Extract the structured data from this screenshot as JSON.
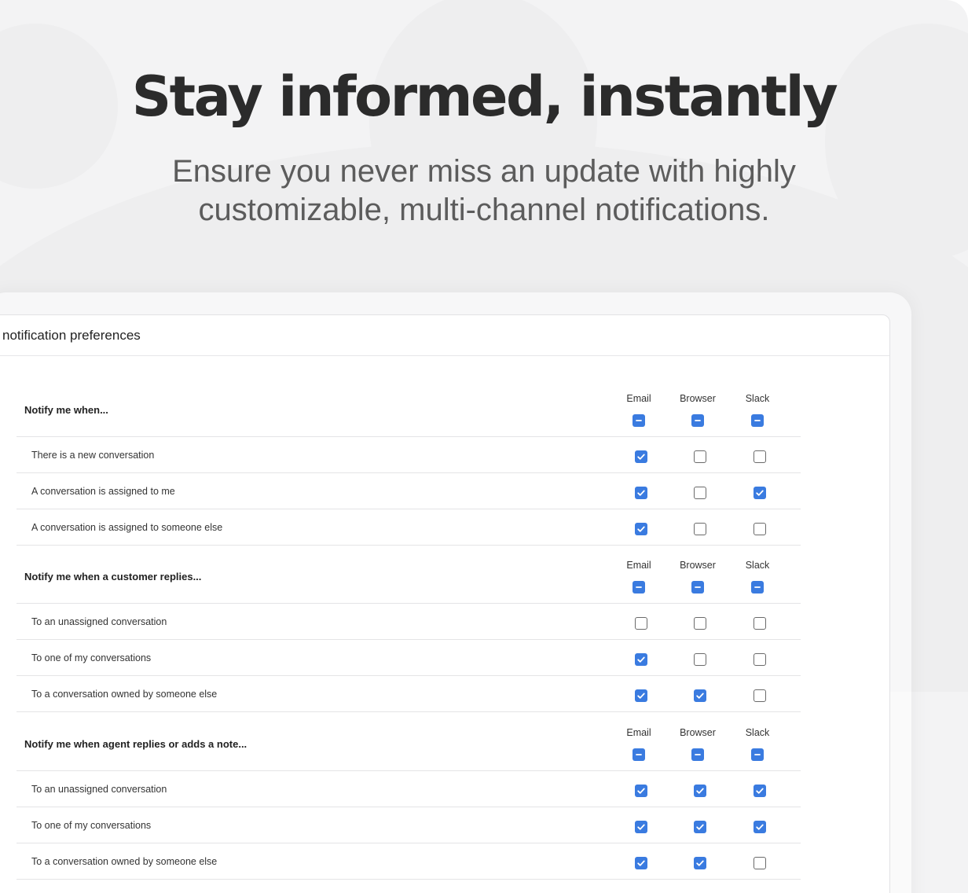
{
  "hero": {
    "title": "Stay informed, instantly",
    "subtitle": "Ensure you never miss an update with highly customizable, multi-channel notifications."
  },
  "panel": {
    "title": "notification preferences",
    "channels": [
      "Email",
      "Browser",
      "Slack"
    ],
    "sections": [
      {
        "label": "Notify me when...",
        "rows": [
          {
            "label": "There is a new conversation",
            "email": true,
            "browser": false,
            "slack": false
          },
          {
            "label": "A conversation is assigned to me",
            "email": true,
            "browser": false,
            "slack": true
          },
          {
            "label": "A conversation is assigned to someone else",
            "email": true,
            "browser": false,
            "slack": false
          }
        ]
      },
      {
        "label": "Notify me when a customer replies...",
        "rows": [
          {
            "label": "To an unassigned conversation",
            "email": false,
            "browser": false,
            "slack": false
          },
          {
            "label": "To one of my conversations",
            "email": true,
            "browser": false,
            "slack": false
          },
          {
            "label": "To a conversation owned by someone else",
            "email": true,
            "browser": true,
            "slack": false
          }
        ]
      },
      {
        "label": "Notify me when agent replies or adds a note...",
        "rows": [
          {
            "label": "To an unassigned conversation",
            "email": true,
            "browser": true,
            "slack": true
          },
          {
            "label": "To one of my conversations",
            "email": true,
            "browser": true,
            "slack": true
          },
          {
            "label": "To a conversation owned by someone else",
            "email": true,
            "browser": true,
            "slack": false
          }
        ]
      }
    ]
  },
  "colors": {
    "accent": "#3a7be0",
    "background": "#f3f3f4",
    "title_text": "#2b2b2b",
    "subtitle_text": "#5c5c5c"
  }
}
